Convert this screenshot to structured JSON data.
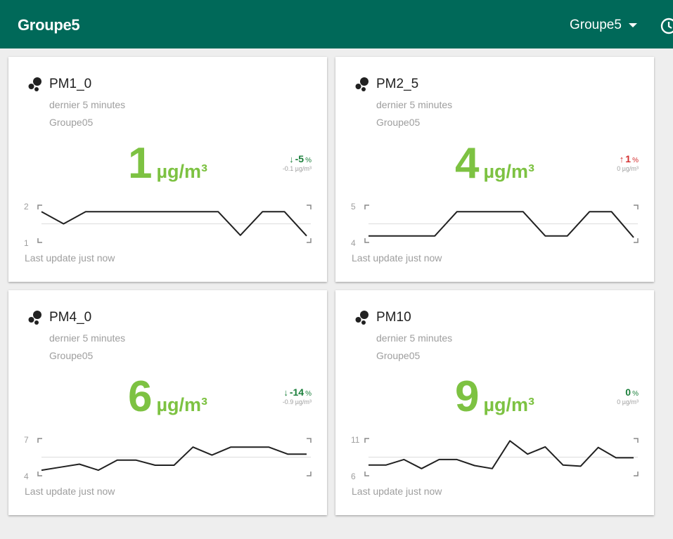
{
  "header": {
    "title": "Groupe5",
    "group_select": "Groupe5",
    "history_icon": "history-icon"
  },
  "cards": [
    {
      "name": "PM1_0",
      "subtitle": "dernier 5 minutes",
      "group": "Groupe05",
      "value": "1",
      "unit": "µg/m³",
      "delta_direction": "down",
      "delta_arrow": "↓",
      "delta_pct": "-5",
      "pct_sign": "%",
      "delta_abs": "-0.1 µg/m³",
      "axis_max": "2",
      "axis_min": "1",
      "last_update": "Last update just now",
      "series": [
        1.9,
        1.5,
        1.9,
        1.9,
        1.9,
        1.9,
        1.9,
        1.9,
        1.9,
        1.12,
        1.9,
        1.9,
        1.1
      ]
    },
    {
      "name": "PM2_5",
      "subtitle": "dernier 5 minutes",
      "group": "Groupe05",
      "value": "4",
      "unit": "µg/m³",
      "delta_direction": "up",
      "delta_arrow": "↑",
      "delta_pct": "1",
      "pct_sign": "%",
      "delta_abs": "0 µg/m³",
      "axis_max": "5",
      "axis_min": "4",
      "last_update": "Last update just now",
      "series": [
        4.1,
        4.1,
        4.1,
        4.1,
        4.9,
        4.9,
        4.9,
        4.9,
        4.1,
        4.1,
        4.9,
        4.9,
        4.05
      ]
    },
    {
      "name": "PM4_0",
      "subtitle": "dernier 5 minutes",
      "group": "Groupe05",
      "value": "6",
      "unit": "µg/m³",
      "delta_direction": "down",
      "delta_arrow": "↓",
      "delta_pct": "-14",
      "pct_sign": "%",
      "delta_abs": "-0.9 µg/m³",
      "axis_max": "7",
      "axis_min": "4",
      "last_update": "Last update just now",
      "series": [
        4.2,
        4.5,
        4.8,
        4.2,
        5.2,
        5.2,
        4.7,
        4.7,
        6.5,
        5.7,
        6.5,
        6.5,
        6.5,
        5.8,
        5.8
      ]
    },
    {
      "name": "PM10",
      "subtitle": "dernier 5 minutes",
      "group": "Groupe05",
      "value": "9",
      "unit": "µg/m³",
      "delta_direction": "flat",
      "delta_arrow": "",
      "delta_pct": "0",
      "pct_sign": "%",
      "delta_abs": "0 µg/m³",
      "axis_max": "11",
      "axis_min": "6",
      "last_update": "Last update just now",
      "series": [
        7.2,
        7.2,
        8.1,
        6.6,
        8.1,
        8.1,
        7.1,
        6.6,
        11.2,
        9.0,
        10.2,
        7.2,
        7.0,
        10.1,
        8.4,
        8.4
      ]
    }
  ]
}
